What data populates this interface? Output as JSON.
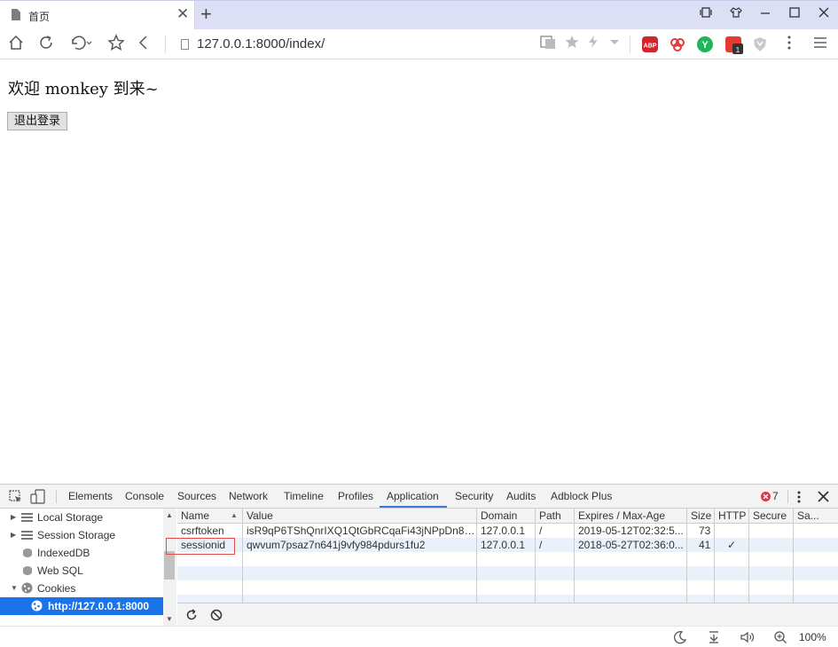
{
  "tab": {
    "title": "首页",
    "close_glyph": "✕",
    "new_tab_glyph": "+"
  },
  "window_controls": [
    "restore-mode",
    "skin",
    "minimize",
    "maximize",
    "close"
  ],
  "address_bar": {
    "url": "127.0.0.1:8000/index/"
  },
  "page": {
    "welcome_text": "欢迎 monkey 到来~",
    "logout_button": "退出登录"
  },
  "devtools": {
    "tabs": [
      "Elements",
      "Console",
      "Sources",
      "Network",
      "Timeline",
      "Profiles",
      "Application",
      "Security",
      "Audits",
      "Adblock Plus"
    ],
    "active_tab": "Application",
    "error_count": "7",
    "sidebar": [
      {
        "label": "Local Storage",
        "expander": "▶",
        "icon": "grid-icon"
      },
      {
        "label": "Session Storage",
        "expander": "▶",
        "icon": "grid-icon"
      },
      {
        "label": "IndexedDB",
        "expander": "",
        "icon": "database-icon"
      },
      {
        "label": "Web SQL",
        "expander": "",
        "icon": "database-icon"
      },
      {
        "label": "Cookies",
        "expander": "▼",
        "icon": "cookie-icon"
      },
      {
        "label": "http://127.0.0.1:8000",
        "expander": "",
        "icon": "cookie-icon",
        "selected": true
      }
    ],
    "cookies_table": {
      "columns": [
        "Name",
        "Value",
        "Domain",
        "Path",
        "Expires / Max-Age",
        "Size",
        "HTTP",
        "Secure",
        "Sa..."
      ],
      "rows": [
        [
          "csrftoken",
          "isR9qP6TShQnrIXQ1QtGbRCqaFi43jNPpDn8aK...",
          "127.0.0.1",
          "/",
          "2019-05-12T02:32:5...",
          "73",
          "",
          "",
          ""
        ],
        [
          "sessionid",
          "qwvum7psaz7n641j9vfy984pdurs1fu2",
          "127.0.0.1",
          "/",
          "2018-05-27T02:36:0...",
          "41",
          "✓",
          "",
          ""
        ]
      ]
    }
  },
  "statusbar": {
    "zoom": "100%"
  },
  "colors": {
    "tabstrip": "#dcdff5",
    "devtools_accent": "#3879d9",
    "selected_row": "#1a73e8",
    "highlight_box": "#e34b4b"
  }
}
